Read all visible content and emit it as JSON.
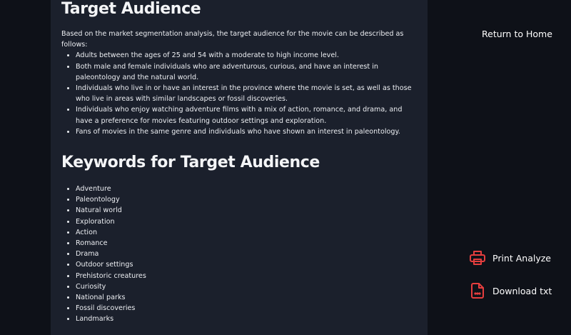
{
  "target_audience": {
    "title": "Target Audience",
    "intro": "Based on the market segmentation analysis, the target audience for the movie can be described as follows:",
    "items": [
      "Adults between the ages of 25 and 54 with a moderate to high income level.",
      "Both male and female individuals who are adventurous, curious, and have an interest in paleontology and the natural world.",
      "Individuals who live in or have an interest in the province where the movie is set, as well as those who live in areas with similar landscapes or fossil discoveries.",
      "Individuals who enjoy watching adventure films with a mix of action, romance, and drama, and have a preference for movies featuring outdoor settings and exploration.",
      "Fans of movies in the same genre and individuals who have shown an interest in paleontology."
    ]
  },
  "keywords": {
    "title": "Keywords for Target Audience",
    "items": [
      "Adventure",
      "Paleontology",
      "Natural world",
      "Exploration",
      "Action",
      "Romance",
      "Drama",
      "Outdoor settings",
      "Prehistoric creatures",
      "Curiosity",
      "National parks",
      "Fossil discoveries",
      "Landmarks"
    ]
  },
  "sidebar": {
    "return_label": "Return to Home",
    "print_label": "Print Analyze",
    "download_label": "Download txt",
    "icon_color": "#e53e3e"
  },
  "colors": {
    "page_background": "#0e1118",
    "panel_background": "#1b202c",
    "text": "#eceef2"
  }
}
